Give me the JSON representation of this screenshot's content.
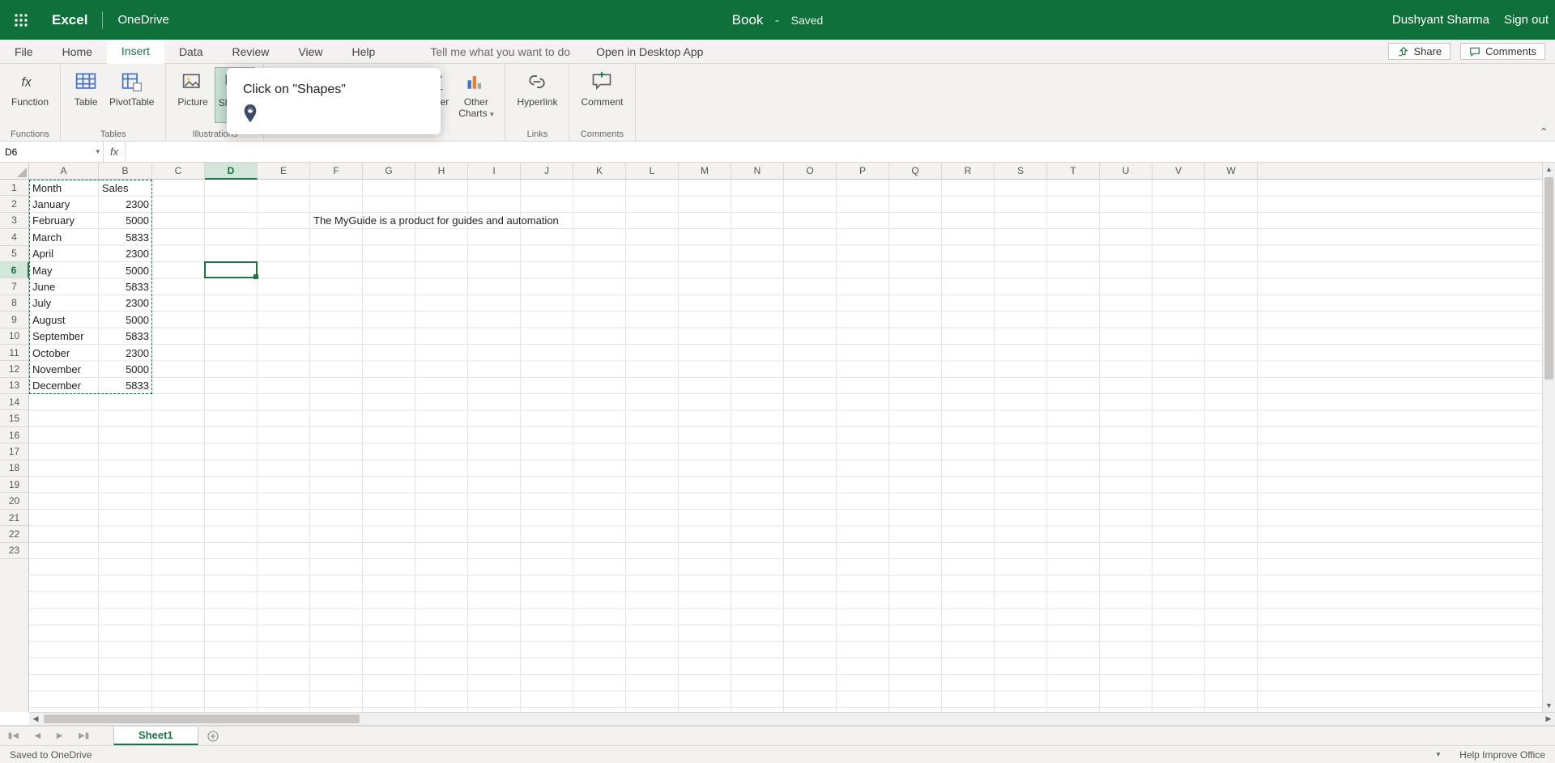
{
  "title_bar": {
    "app_name": "Excel",
    "drive": "OneDrive",
    "doc_title": "Book",
    "doc_status": "Saved",
    "user_name": "Dushyant Sharma",
    "sign_out": "Sign out"
  },
  "tabs": {
    "file": "File",
    "home": "Home",
    "insert": "Insert",
    "data": "Data",
    "review": "Review",
    "view": "View",
    "help": "Help",
    "tell_me": "Tell me what you want to do",
    "open_desktop": "Open in Desktop App",
    "share": "Share",
    "comments": "Comments"
  },
  "ribbon": {
    "function": "Function",
    "functions_group": "Functions",
    "table": "Table",
    "pivottable": "PivotTable",
    "tables_group": "Tables",
    "picture": "Picture",
    "shapes": "Shapes",
    "illustrations_group": "Illustrations",
    "scatter": "Scatter",
    "other_charts": "Other\nCharts",
    "charts_group": "Charts",
    "hyperlink": "Hyperlink",
    "links_group": "Links",
    "comment": "Comment",
    "comments_group": "Comments"
  },
  "tooltip": {
    "text": "Click on \"Shapes\""
  },
  "formula_bar": {
    "name_box": "D6",
    "fx": "fx",
    "formula": ""
  },
  "grid": {
    "col_headers": [
      "A",
      "B",
      "C",
      "D",
      "E",
      "F",
      "G",
      "H",
      "I",
      "J",
      "K",
      "L",
      "M",
      "N",
      "O",
      "P",
      "Q",
      "R",
      "S",
      "T",
      "U",
      "V",
      "W"
    ],
    "row_count": 23,
    "active_cell": "D6",
    "selected_col": "D",
    "selected_row": 6,
    "headers": {
      "A1": "Month",
      "B1": "Sales"
    },
    "data_rows": [
      {
        "month": "January",
        "sales": 2300
      },
      {
        "month": "February",
        "sales": 5000
      },
      {
        "month": "March",
        "sales": 5833
      },
      {
        "month": "April",
        "sales": 2300
      },
      {
        "month": "May",
        "sales": 5000
      },
      {
        "month": "June",
        "sales": 5833
      },
      {
        "month": "July",
        "sales": 2300
      },
      {
        "month": "August",
        "sales": 5000
      },
      {
        "month": "September",
        "sales": 5833
      },
      {
        "month": "October",
        "sales": 2300
      },
      {
        "month": "November",
        "sales": 5000
      },
      {
        "month": "December",
        "sales": 5833
      }
    ],
    "floating_text": {
      "cell": "F3",
      "value": "The MyGuide is a product for guides and automation"
    }
  },
  "sheet_tabs": {
    "sheet1": "Sheet1"
  },
  "status_bar": {
    "left": "Saved to OneDrive",
    "help": "Help Improve Office"
  }
}
